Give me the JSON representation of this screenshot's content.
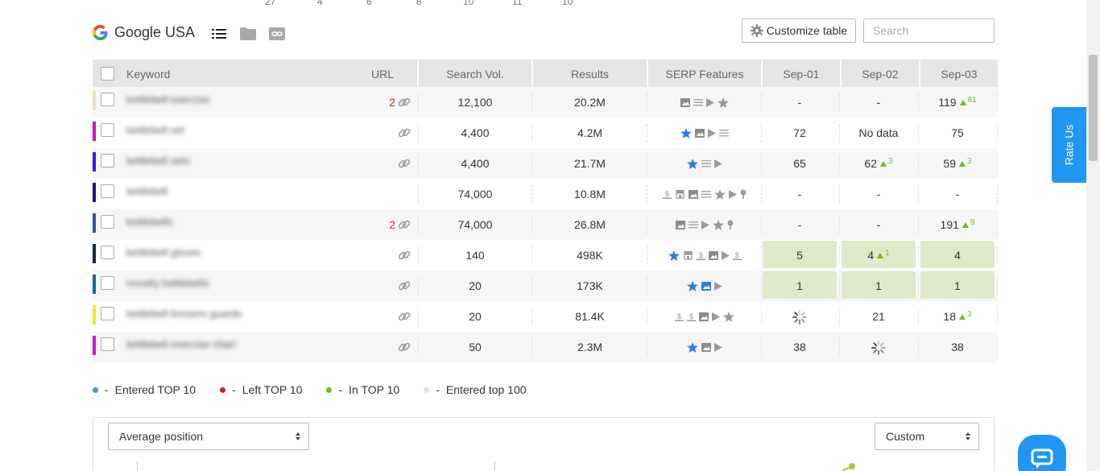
{
  "top_numbers": [
    "27",
    "4",
    "6",
    "8",
    "10",
    "11",
    "10"
  ],
  "header": {
    "engine_label": "Google USA"
  },
  "toolbar": {
    "customize_label": "Customize table",
    "search_placeholder": "Search"
  },
  "table": {
    "columns": [
      "Keyword",
      "URL",
      "Search Vol.",
      "Results",
      "SERP Features",
      "Sep-01",
      "Sep-02",
      "Sep-03"
    ],
    "rows": [
      {
        "color": "#e8e2c4",
        "keyword": "kettlebell exercise",
        "url_count": "2",
        "link": true,
        "volume": "12,100",
        "results": "20.2M",
        "serp": [
          "image-icon",
          "list-icon",
          "video-icon",
          "star-icon"
        ],
        "sep01": "-",
        "sep02": "-",
        "sep03": "119",
        "sep03_delta": "81"
      },
      {
        "color": "#b71cb7",
        "keyword": "kettlebell set",
        "url_count": "",
        "link": true,
        "volume": "4,400",
        "results": "4.2M",
        "serp": [
          "star-blue-icon",
          "image-icon",
          "video-icon",
          "list-icon"
        ],
        "sep01": "72",
        "sep02": "No data",
        "sep03": "75"
      },
      {
        "color": "#3d18d8",
        "keyword": "kettlebell sets",
        "url_count": "",
        "link": true,
        "volume": "4,400",
        "results": "21.7M",
        "serp": [
          "star-blue-icon",
          "list-icon",
          "video-icon"
        ],
        "sep01": "65",
        "sep02": "62",
        "sep02_delta": "3",
        "sep03": "59",
        "sep03_delta": "3"
      },
      {
        "color": "#1c1580",
        "keyword": "kettlebell",
        "url_count": "",
        "link": false,
        "volume": "74,000",
        "results": "10.8M",
        "serp": [
          "dollar-icon",
          "shop-icon",
          "image-icon",
          "list-icon",
          "star-icon",
          "video-icon",
          "pin-icon"
        ],
        "sep01": "-",
        "sep02": "-",
        "sep03": "-"
      },
      {
        "color": "#3f4f9a",
        "keyword": "kettlebells",
        "url_count": "2",
        "link": true,
        "volume": "74,000",
        "results": "26.8M",
        "serp": [
          "image-icon",
          "list-icon",
          "video-icon",
          "star-icon",
          "pin-icon"
        ],
        "sep01": "-",
        "sep02": "-",
        "sep03": "191",
        "sep03_delta": "9"
      },
      {
        "color": "#1a2540",
        "keyword": "kettlebell gloves",
        "url_count": "",
        "link": true,
        "volume": "140",
        "results": "498K",
        "serp": [
          "star-blue-icon",
          "shop-icon",
          "dollar-icon",
          "image-icon",
          "video-icon",
          "dollar-icon"
        ],
        "sep01": "5",
        "sep02": "4",
        "sep02_delta": "1",
        "sep03": "4",
        "highlight": true
      },
      {
        "color": "#1a6a8a",
        "keyword": "novelty kettlebells",
        "url_count": "",
        "link": true,
        "volume": "20",
        "results": "173K",
        "serp": [
          "star-blue-icon",
          "image-blue-icon",
          "video-icon"
        ],
        "sep01": "1",
        "sep02": "1",
        "sep03": "1",
        "highlight": true
      },
      {
        "color": "#e6ec3a",
        "keyword": "kettlebell forearm guards",
        "url_count": "",
        "link": true,
        "volume": "20",
        "results": "81.4K",
        "serp": [
          "dollar-icon",
          "dollar-icon",
          "image-icon",
          "video-icon",
          "star-icon"
        ],
        "sep01": "",
        "sep01_loading": true,
        "sep02": "21",
        "sep03": "18",
        "sep03_delta": "3"
      },
      {
        "color": "#c21ec9",
        "keyword": "kettlebell exercise chart",
        "url_count": "",
        "link": true,
        "volume": "50",
        "results": "2.3M",
        "serp": [
          "star-blue-icon",
          "image-icon",
          "video-icon"
        ],
        "sep01": "38",
        "sep02": "",
        "sep02_loading": true,
        "sep03": "38"
      }
    ]
  },
  "legend": [
    {
      "color": "#4a90e2",
      "label": "Entered TOP 10"
    },
    {
      "color": "#c0272d",
      "label": "Left TOP 10"
    },
    {
      "color": "#7ab51d",
      "label": "In TOP 10"
    },
    {
      "color": "#e6e3cf",
      "label": "Entered top 100"
    }
  ],
  "chart_controls": {
    "metric": "Average position",
    "range": "Custom"
  },
  "rate_us": "Rate Us"
}
